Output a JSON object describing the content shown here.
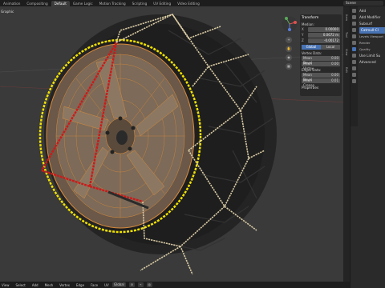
{
  "topbar": {
    "tabs": [
      "Animation",
      "Compositing",
      "Default",
      "Game Logic",
      "Motion Tracking",
      "Scripting",
      "UV Editing",
      "Video Editing"
    ],
    "active_index": 2,
    "scene": "Scene"
  },
  "viewport": {
    "view_label": "Graphic"
  },
  "n_panel": {
    "header": "Transform",
    "median_label": "Median:",
    "x_key": "X",
    "x_value": "0.00000",
    "y_key": "Y",
    "y_value": "0.0672 m",
    "z_key": "Z",
    "z_value": "-0.00172",
    "toggle_global": "Global",
    "toggle_local": "Local",
    "vertex_section": "Vertex Data:",
    "mean_bevel_label": "Mean Bevel",
    "mean_bevel_value": "0.00",
    "mean_vertex_label": "Mean Vertex",
    "mean_vertex_value": "0.00",
    "edge_section": "Edges Data:",
    "edge_bevel_label": "Mean Bevel",
    "edge_bevel_value": "0.00",
    "edge_crease_label": "Mean Crease",
    "edge_crease_value": "0.01",
    "properties_label": "Properties"
  },
  "sidetabs": [
    "Item",
    "Tool",
    "View",
    "Edit"
  ],
  "right_panel": {
    "items": [
      "Add",
      "Add Modifier",
      "Subsurf",
      "Catmull-Cl",
      "Levels Viewport",
      "Render",
      "Quality",
      "Use Limit Su",
      "Advanced"
    ]
  },
  "statusbar": {
    "left_items": [
      "View",
      "Select",
      "Add",
      "Mesh",
      "Vertex",
      "Edge",
      "Face",
      "UV"
    ],
    "orientation": "Global"
  },
  "colors": {
    "chain_gold": "#d8c9a3",
    "chain_yellow": "#f2e300",
    "chain_red": "#cc1a1a",
    "rim_orange": "#d88a3a"
  }
}
